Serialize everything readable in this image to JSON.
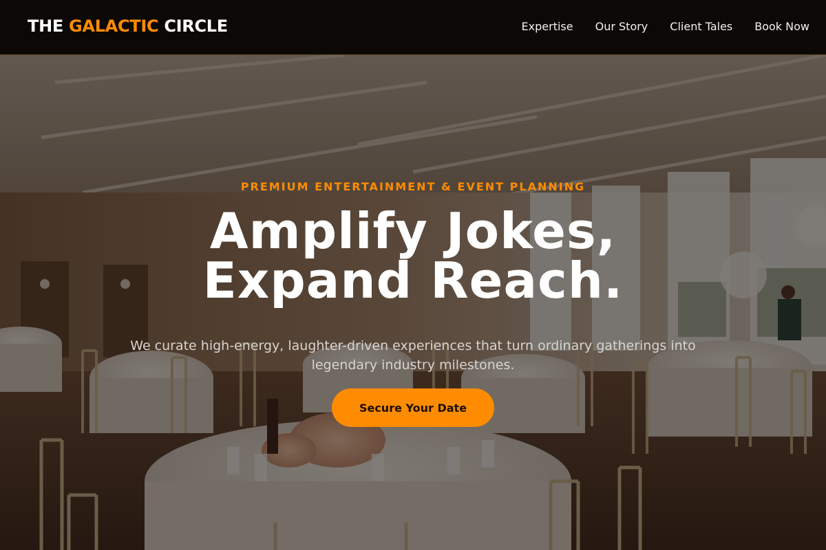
{
  "brand": {
    "prefix": "THE",
    "accent": "GALACTIC",
    "suffix": "CIRCLE",
    "accent_color": "#ff8c00"
  },
  "nav": {
    "items": [
      {
        "label": "Expertise"
      },
      {
        "label": "Our Story"
      },
      {
        "label": "Client Tales"
      },
      {
        "label": "Book Now"
      }
    ]
  },
  "hero": {
    "eyebrow": "PREMIUM ENTERTAINMENT & EVENT PLANNING",
    "headline_line1": "Amplify Jokes,",
    "headline_line2": "Expand Reach.",
    "subtext": "We curate high-energy, laughter-driven experiences that turn ordinary gatherings into legendary industry milestones.",
    "cta_label": "Secure Your Date",
    "background_image": "banquet-hall-photo"
  },
  "colors": {
    "header_bg": "#0c0806",
    "accent": "#ff8c00",
    "text_light": "#ffffff"
  }
}
